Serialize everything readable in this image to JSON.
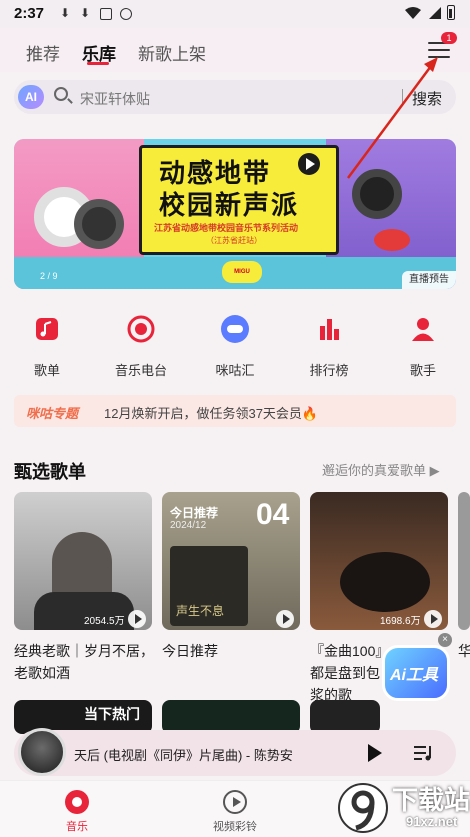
{
  "status_bar": {
    "time": "2:37"
  },
  "header": {
    "tabs": [
      {
        "label": "推荐"
      },
      {
        "label": "乐库"
      },
      {
        "label": "新歌上架"
      }
    ],
    "menu_badge": "1"
  },
  "search": {
    "ai_label": "AI",
    "placeholder": "宋亚轩体贴",
    "button": "搜索"
  },
  "banner": {
    "title_line1": "动感地带",
    "title_line2": "校园新声派",
    "subtitle": "江苏省动感地带校园音乐节系列活动",
    "subtitle2": "（江苏省赶站）",
    "logo_text": "MIGU",
    "tag": "直播预告",
    "page": "2 / 9"
  },
  "quick_nav": [
    {
      "label": "歌单",
      "color": "#e8243b"
    },
    {
      "label": "音乐电台",
      "color": "#e8243b"
    },
    {
      "label": "咪咕汇",
      "color": "#5b7cff"
    },
    {
      "label": "排行榜",
      "color": "#e8243b"
    },
    {
      "label": "歌手",
      "color": "#e8243b"
    }
  ],
  "promo": {
    "tag": "咪咕专题",
    "text": "12月焕新开启，做任务领37天会员🔥"
  },
  "section": {
    "title": "甄选歌单",
    "more": "邂逅你的真爱歌单 ▶"
  },
  "cards": [
    {
      "count": "2054.5万",
      "caption": "经典老歌｜岁月不居，老歌如酒"
    },
    {
      "header": "今日推荐",
      "date": "2024/12",
      "number": "04",
      "art_text": "声生不息",
      "caption": "今日推荐"
    },
    {
      "count": "1698.6万",
      "caption": "『金曲100』都是盘到包浆的歌"
    },
    {
      "caption": "华"
    }
  ],
  "strip": {
    "hot_label": "当下热门"
  },
  "player": {
    "title": "天后 (电视剧《同伊》片尾曲) - 陈势安"
  },
  "ai_float": {
    "label": "Ai工具"
  },
  "bottom_nav": [
    {
      "label": "音乐"
    },
    {
      "label": "视频彩铃"
    }
  ],
  "watermark": {
    "brand": "下载站",
    "url": "91xz.net"
  },
  "colors": {
    "accent": "#e8243b",
    "annotation_arrow": "#d9261c"
  }
}
